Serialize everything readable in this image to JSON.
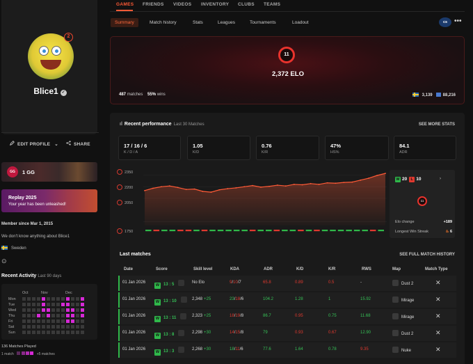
{
  "nav": {
    "tabs": [
      "GAMES",
      "FRIENDS",
      "VIDEOS",
      "INVENTORY",
      "CLUBS",
      "TEAMS"
    ],
    "active_tab": "GAMES",
    "subtabs": [
      "Summary",
      "Match history",
      "Stats",
      "Leagues",
      "Tournaments",
      "Loadout"
    ],
    "active_subtab": "Summary",
    "game_badge": "cs",
    "more": "•••"
  },
  "profile": {
    "username": "Blice1",
    "level_badge": "2",
    "edit_label": "EDIT PROFILE",
    "share_label": "SHARE",
    "gg_label": "1 GG",
    "gg_icon_text": "GG",
    "replay_title": "Replay 2025",
    "replay_sub": "Your year has been unleashed!",
    "member_since": "Member since Mar 1, 2015",
    "about": "We don't know anything about Blice1",
    "country": "Sweden",
    "accent": "#ff5a36"
  },
  "activity": {
    "title": "Recent Activity",
    "subtitle": "Last 90 days",
    "months": [
      "Oct",
      "Nov",
      "Dec"
    ],
    "days": [
      "Mon",
      "Tue",
      "Wed",
      "Thu",
      "Fri",
      "Sat",
      "Sun"
    ],
    "grid": [
      [
        0,
        0,
        0,
        0,
        1,
        0,
        0,
        0,
        0,
        1,
        0,
        0,
        1
      ],
      [
        0,
        0,
        0,
        0,
        1,
        0,
        0,
        0,
        1,
        1,
        0,
        0,
        1
      ],
      [
        0,
        0,
        0,
        0,
        1,
        1,
        0,
        0,
        0,
        1,
        1,
        0,
        1
      ],
      [
        0,
        0,
        0,
        1,
        0,
        1,
        0,
        0,
        0,
        1,
        1,
        0,
        1
      ],
      [
        0,
        0,
        0,
        0,
        0,
        0,
        0,
        0,
        0,
        1,
        1,
        0,
        0
      ],
      [
        0,
        0,
        0,
        0,
        0,
        0,
        0,
        0,
        0,
        0,
        0,
        0,
        0
      ],
      [
        0,
        0,
        0,
        0,
        0,
        0,
        0,
        0,
        0,
        0,
        0,
        0,
        0
      ]
    ],
    "matches_played": "136 Matches Played",
    "legend_low": "1 match",
    "legend_high": "+5 matches",
    "on_color": "#d629d6",
    "off_color": "#3a3a3a"
  },
  "elo": {
    "level": "11",
    "value": "2,372 ELO",
    "matches_count": "487",
    "matches_label": "matches",
    "winrate": "55%",
    "winrate_label": "wins",
    "rank_country": "3,139",
    "rank_global": "88,216"
  },
  "performance": {
    "title": "Recent performance",
    "subtitle": "Last 30 Matches",
    "see_more": "SEE MORE STATS",
    "stats": [
      {
        "value": "17 / 16 / 6",
        "label": "K / D / A"
      },
      {
        "value": "1.05",
        "label": "K/D"
      },
      {
        "value": "0.76",
        "label": "K/R"
      },
      {
        "value": "47%",
        "label": "HS%"
      },
      {
        "value": "84.1",
        "label": "ADR"
      }
    ],
    "side": {
      "wins": "20",
      "losses": "10",
      "ring": "11",
      "elo_change_label": "Elo change",
      "elo_change_value": "+189",
      "streak_label": "Longest Win Streak",
      "streak_value": "6"
    }
  },
  "chart_data": {
    "type": "area",
    "title": "",
    "xlabel": "",
    "ylabel": "",
    "yticks": [
      2350,
      2200,
      2050,
      1750
    ],
    "ylim": [
      1700,
      2400
    ],
    "x": [
      1,
      2,
      3,
      4,
      5,
      6,
      7,
      8,
      9,
      10,
      11,
      12,
      13,
      14,
      15,
      16,
      17,
      18,
      19,
      20,
      21,
      22,
      23,
      24,
      25,
      26,
      27,
      28,
      29,
      30
    ],
    "series": [
      {
        "values": [
          2150,
          2180,
          2200,
          2210,
          2190,
          2165,
          2170,
          2140,
          2130,
          2160,
          2175,
          2185,
          2200,
          2215,
          2195,
          2205,
          2220,
          2210,
          2230,
          2225,
          2240,
          2230,
          2250,
          2245,
          2255,
          2260,
          2285,
          2310,
          2345,
          2372
        ]
      }
    ],
    "results": [
      "W",
      "L",
      "W",
      "W",
      "L",
      "L",
      "W",
      "L",
      "W",
      "W",
      "W",
      "W",
      "W",
      "L",
      "W",
      "W",
      "L",
      "W",
      "W",
      "L",
      "W",
      "L",
      "W",
      "W",
      "W",
      "W",
      "W",
      "W",
      "L",
      "W"
    ],
    "line_color": "#ff5a36",
    "win_color": "#2fb84a",
    "loss_color": "#e0392f"
  },
  "matches": {
    "title": "Last matches",
    "see_full": "SEE FULL MATCH HISTORY",
    "headers": [
      "Date",
      "Score",
      "Skill level",
      "KDA",
      "ADR",
      "K/D",
      "K/R",
      "RWS",
      "Map",
      "Match Type"
    ],
    "rows": [
      {
        "date": "01 Jan 2026",
        "result": "W",
        "score": "13 : 5",
        "skill": "No Elo",
        "skill_change": "",
        "kda": [
          "9",
          "10",
          "7"
        ],
        "adr": "65.8",
        "kd": "0.89",
        "kr": "0.5",
        "rws": "-",
        "map": "Dust 2"
      },
      {
        "date": "01 Jan 2026",
        "result": "W",
        "score": "13 : 10",
        "skill": "2,348",
        "skill_change": "+25",
        "kda": [
          "23",
          "18",
          "6"
        ],
        "adr": "104.2",
        "kd": "1.28",
        "kr": "1",
        "rws": "15.92",
        "map": "Mirage"
      },
      {
        "date": "01 Jan 2026",
        "result": "W",
        "score": "13 : 11",
        "skill": "2,323",
        "skill_change": "+25",
        "kda": [
          "18",
          "19",
          "8"
        ],
        "adr": "86.7",
        "kd": "0.95",
        "kr": "0.75",
        "rws": "11.68",
        "map": "Mirage"
      },
      {
        "date": "01 Jan 2026",
        "result": "W",
        "score": "13 : 8",
        "skill": "2,298",
        "skill_change": "+30",
        "kda": [
          "14",
          "15",
          "8"
        ],
        "adr": "79",
        "kd": "0.93",
        "kr": "0.67",
        "rws": "12.90",
        "map": "Dust 2"
      },
      {
        "date": "01 Jan 2026",
        "result": "W",
        "score": "13 : 3",
        "skill": "2,268",
        "skill_change": "+30",
        "kda": [
          "18",
          "11",
          "6"
        ],
        "adr": "77.6",
        "kd": "1.64",
        "kr": "0.78",
        "rws": "9.35",
        "map": "Nuke"
      }
    ]
  }
}
